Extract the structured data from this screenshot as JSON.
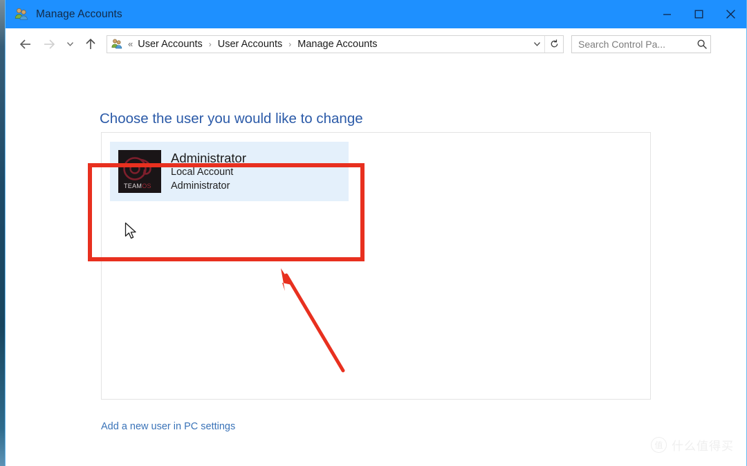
{
  "window": {
    "title": "Manage Accounts",
    "title_icon": "user-accounts-icon",
    "accent_color": "#1e90ff",
    "controls": {
      "minimize": "Minimize",
      "maximize": "Maximize",
      "close": "Close"
    }
  },
  "nav": {
    "back": "Back",
    "forward": "Forward",
    "recent_dropdown": "Recent locations",
    "up": "Up one level",
    "breadcrumb": {
      "icon": "user-accounts-icon",
      "overflow": "«",
      "separator": "›",
      "items": [
        {
          "label": "User Accounts"
        },
        {
          "label": "User Accounts"
        },
        {
          "label": "Manage Accounts"
        }
      ]
    },
    "address_dropdown": "Previous locations",
    "refresh": "Refresh"
  },
  "search": {
    "value": "",
    "placeholder": "Search Control Pa...",
    "icon": "search-icon"
  },
  "main": {
    "heading": "Choose the user you would like to change",
    "accounts": [
      {
        "name": "Administrator",
        "account_type": "Local Account",
        "role": "Administrator",
        "avatar": {
          "logo_text_light": "TEAM",
          "logo_text_accent": "OS",
          "background": "#1a1517",
          "accent": "#9c2733"
        },
        "selected": true
      }
    ],
    "add_user_link": "Add a new user in PC settings"
  },
  "annotations": {
    "highlight_box": {
      "color": "#e8301f",
      "target": "administrator-account-tile"
    },
    "pointer_arrow": {
      "color": "#e8301f",
      "points_to": "administrator-account-tile"
    }
  },
  "watermark": {
    "mark": "值",
    "text": "什么值得买"
  }
}
